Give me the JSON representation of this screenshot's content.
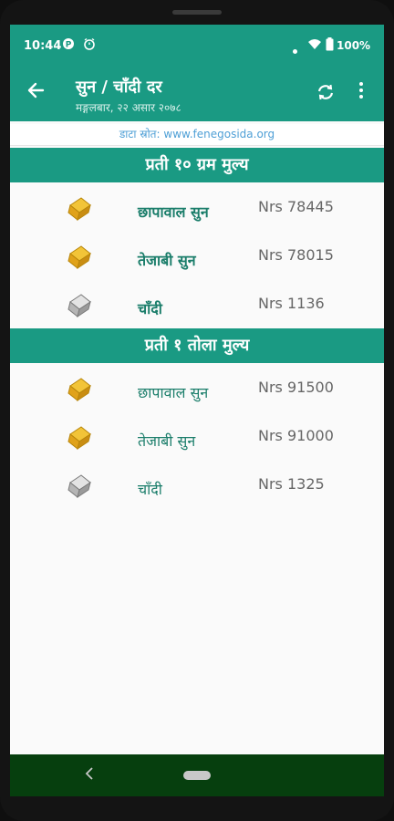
{
  "status_bar": {
    "time": "10:44",
    "icons": [
      "p-icon",
      "alarm-icon",
      "dot",
      "wifi-icon",
      "battery-icon"
    ],
    "battery": "100%"
  },
  "toolbar": {
    "title": "सुन / चाँदी दर",
    "subtitle": "मङ्गलबार, २२ असार २०७८"
  },
  "source": "डाटा स्रोत: www.fenegosida.org",
  "sections": [
    {
      "header": "प्रती १० ग्रम मुल्य",
      "rows": [
        {
          "name": "छापावाल सुन",
          "price": "Nrs 78445",
          "icon": "gold-bar-icon"
        },
        {
          "name": "तेजाबी सुन",
          "price": "Nrs 78015",
          "icon": "gold-bar-icon"
        },
        {
          "name": "चाँदी",
          "price": "Nrs 1136",
          "icon": "silver-bar-icon"
        }
      ]
    },
    {
      "header": "प्रती १ तोला मुल्य",
      "rows": [
        {
          "name": "छापावाल सुन",
          "price": "Nrs 91500",
          "icon": "gold-bar-icon"
        },
        {
          "name": "तेजाबी सुन",
          "price": "Nrs 91000",
          "icon": "gold-bar-icon"
        },
        {
          "name": "चाँदी",
          "price": "Nrs 1325",
          "icon": "silver-bar-icon"
        }
      ]
    }
  ],
  "colors": {
    "primary": "#1a9a83",
    "accent_text": "#1a7d6a",
    "gold": "#e0a21a",
    "silver": "#a0a0a0",
    "nav_bar": "#063f0e"
  }
}
